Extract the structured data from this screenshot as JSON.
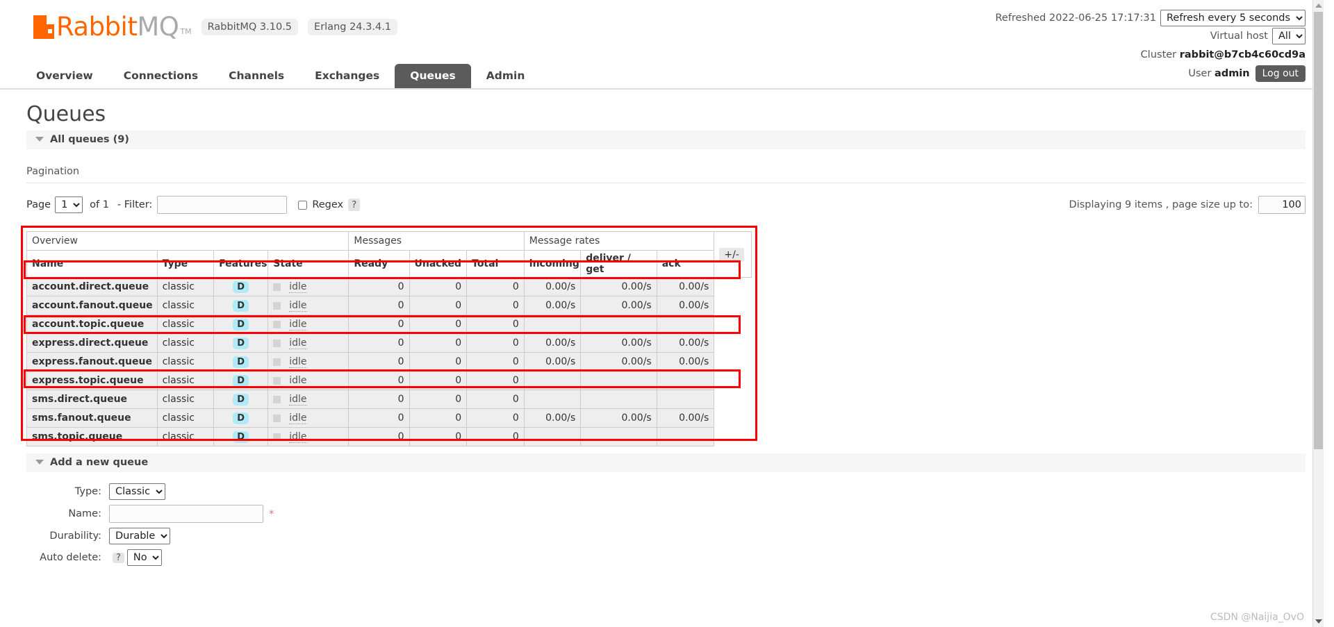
{
  "brand": {
    "name_primary": "Rabbit",
    "name_secondary": "MQ",
    "trademark": "TM",
    "version_pill": "RabbitMQ 3.10.5",
    "erlang_pill": "Erlang 24.3.4.1",
    "accent_color": "#ff6600"
  },
  "header": {
    "refreshed_label": "Refreshed 2022-06-25 17:17:31",
    "refresh_select_value": "Refresh every 5 seconds",
    "refresh_options": [
      "Refresh every 5 seconds"
    ],
    "vhost_label": "Virtual host",
    "vhost_value": "All",
    "vhost_options": [
      "All"
    ],
    "cluster_label": "Cluster",
    "cluster_value": "rabbit@b7cb4c60cd9a",
    "user_label": "User",
    "user_value": "admin",
    "logout_label": "Log out"
  },
  "nav": {
    "tabs": [
      {
        "label": "Overview",
        "active": false
      },
      {
        "label": "Connections",
        "active": false
      },
      {
        "label": "Channels",
        "active": false
      },
      {
        "label": "Exchanges",
        "active": false
      },
      {
        "label": "Queues",
        "active": true
      },
      {
        "label": "Admin",
        "active": false
      }
    ]
  },
  "page": {
    "title": "Queues",
    "all_queues_label": "All queues (9)"
  },
  "pagination": {
    "section_label": "Pagination",
    "page_label": "Page",
    "page_value": "1",
    "page_options": [
      "1"
    ],
    "of_label": "of 1",
    "filter_label": "- Filter:",
    "filter_value": "",
    "regex_label": "Regex",
    "regex_help": "?",
    "displaying_label": "Displaying 9 items , page size up to:",
    "page_size_value": "100"
  },
  "table": {
    "group_headers": [
      {
        "label": "Overview",
        "span": 4
      },
      {
        "label": "Messages",
        "span": 3
      },
      {
        "label": "Message rates",
        "span": 3
      }
    ],
    "expand_button": "+/-",
    "columns": [
      "Name",
      "Type",
      "Features",
      "State",
      "Ready",
      "Unacked",
      "Total",
      "incoming",
      "deliver / get",
      "ack"
    ],
    "rows": [
      {
        "name": "account.direct.queue",
        "type": "classic",
        "features": "D",
        "state": "idle",
        "ready": "0",
        "unacked": "0",
        "total": "0",
        "incoming": "0.00/s",
        "deliver_get": "0.00/s",
        "ack": "0.00/s",
        "highlighted": false
      },
      {
        "name": "account.fanout.queue",
        "type": "classic",
        "features": "D",
        "state": "idle",
        "ready": "0",
        "unacked": "0",
        "total": "0",
        "incoming": "0.00/s",
        "deliver_get": "0.00/s",
        "ack": "0.00/s",
        "highlighted": false
      },
      {
        "name": "account.topic.queue",
        "type": "classic",
        "features": "D",
        "state": "idle",
        "ready": "0",
        "unacked": "0",
        "total": "0",
        "incoming": "",
        "deliver_get": "",
        "ack": "",
        "highlighted": true
      },
      {
        "name": "express.direct.queue",
        "type": "classic",
        "features": "D",
        "state": "idle",
        "ready": "0",
        "unacked": "0",
        "total": "0",
        "incoming": "0.00/s",
        "deliver_get": "0.00/s",
        "ack": "0.00/s",
        "highlighted": false
      },
      {
        "name": "express.fanout.queue",
        "type": "classic",
        "features": "D",
        "state": "idle",
        "ready": "0",
        "unacked": "0",
        "total": "0",
        "incoming": "0.00/s",
        "deliver_get": "0.00/s",
        "ack": "0.00/s",
        "highlighted": false
      },
      {
        "name": "express.topic.queue",
        "type": "classic",
        "features": "D",
        "state": "idle",
        "ready": "0",
        "unacked": "0",
        "total": "0",
        "incoming": "",
        "deliver_get": "",
        "ack": "",
        "highlighted": true
      },
      {
        "name": "sms.direct.queue",
        "type": "classic",
        "features": "D",
        "state": "idle",
        "ready": "0",
        "unacked": "0",
        "total": "0",
        "incoming": "",
        "deliver_get": "",
        "ack": "",
        "highlighted": false
      },
      {
        "name": "sms.fanout.queue",
        "type": "classic",
        "features": "D",
        "state": "idle",
        "ready": "0",
        "unacked": "0",
        "total": "0",
        "incoming": "0.00/s",
        "deliver_get": "0.00/s",
        "ack": "0.00/s",
        "highlighted": false
      },
      {
        "name": "sms.topic.queue",
        "type": "classic",
        "features": "D",
        "state": "idle",
        "ready": "0",
        "unacked": "0",
        "total": "0",
        "incoming": "",
        "deliver_get": "",
        "ack": "",
        "highlighted": true
      }
    ]
  },
  "add_queue": {
    "section_label": "Add a new queue",
    "type_label": "Type:",
    "type_value": "Classic",
    "type_options": [
      "Classic"
    ],
    "name_label": "Name:",
    "name_value": "",
    "name_required_mark": "*",
    "durability_label": "Durability:",
    "durability_value": "Durable",
    "durability_options": [
      "Durable"
    ],
    "autodelete_label": "Auto delete:",
    "autodelete_help": "?",
    "autodelete_value": "No",
    "autodelete_options": [
      "No"
    ]
  },
  "watermark": {
    "text": "CSDN @Naijia_OvO"
  }
}
